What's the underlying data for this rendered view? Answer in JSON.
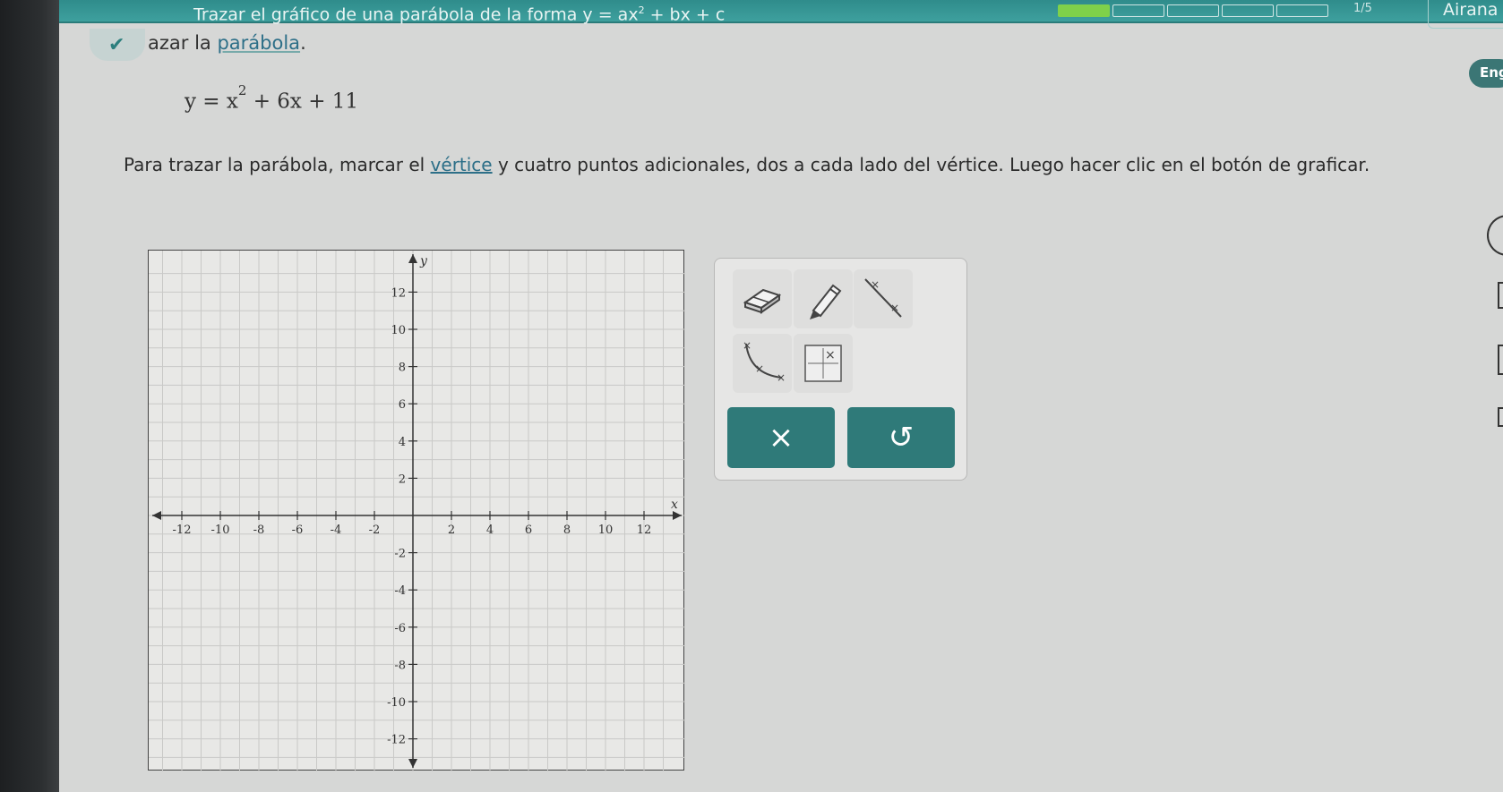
{
  "header": {
    "topic_prefix": "Trazar el gráfico de una parábola de la forma y = ax",
    "topic_exp": "2",
    "topic_suffix": " + bx + c",
    "progress_count": "1/5",
    "progress_segments_total": 5,
    "progress_segments_done": 1,
    "user_name": "Airana Zoe"
  },
  "task": {
    "title_prefix": "azar la",
    "title_link": "parábola",
    "title_suffix": ".",
    "language_button": "Eng"
  },
  "equation": {
    "lhs": "y = x",
    "exp": "2",
    "rhs": " + 6x + 11"
  },
  "instructions": {
    "part1": "Para trazar la parábola, marcar el",
    "link": "vértice",
    "part2": "y cuatro puntos adicionales, dos a cada lado del vértice. Luego hacer clic en el botón de graficar."
  },
  "graph": {
    "x_label": "x",
    "y_label": "y",
    "x_range": [
      -13,
      13
    ],
    "y_range": [
      -13,
      13
    ],
    "x_ticks": [
      "-12",
      "-10",
      "-8",
      "-6",
      "-4",
      "-2",
      "2",
      "4",
      "6",
      "8",
      "10",
      "12"
    ],
    "y_ticks": [
      "12",
      "10",
      "8",
      "6",
      "4",
      "2",
      "-2",
      "-4",
      "-6",
      "-8",
      "-10",
      "-12"
    ]
  },
  "tools": {
    "eraser_icon": "eraser-icon",
    "pencil_icon": "pencil-icon",
    "line_icon": "line-icon",
    "parabola_icon": "parabola-icon",
    "point_icon": "point-icon",
    "clear_label": "×",
    "undo_label": "↺"
  },
  "colors": {
    "teal": "#2f7a79",
    "topbar": "#3ea09e"
  }
}
